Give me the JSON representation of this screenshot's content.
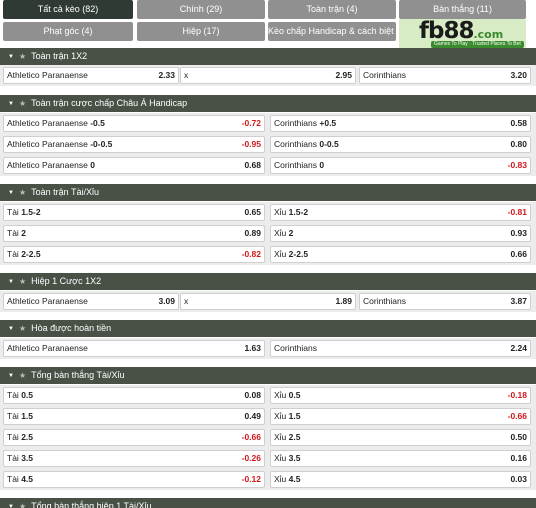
{
  "tabs": [
    {
      "label": "Tất cả kèo (82)"
    },
    {
      "label": "Chính (29)"
    },
    {
      "label": "Toàn trận (4)"
    },
    {
      "label": "Bàn thắng (11)"
    },
    {
      "label": "Phạt góc (4)"
    },
    {
      "label": "Hiệp (17)"
    },
    {
      "label": "Kèo chấp Handicap & cách biệt (3)"
    }
  ],
  "logo": {
    "name": "fb88",
    "domain": ".com",
    "tagline": "Games To Play · Trusted Places To Bet",
    "bg": "#d7ecc5"
  },
  "colors": {
    "section_header": "#495147",
    "active_tab": "#2f3a34",
    "inactive_tab": "#909090",
    "negative_odd": "#d0181b"
  },
  "sections": [
    {
      "title": "Toàn trận 1X2",
      "rows": [
        [
          {
            "label": "Athletico Paranaense",
            "odd": "2.33"
          },
          {
            "label": "x",
            "odd": "2.95"
          },
          {
            "label": "Corinthians",
            "odd": "3.20"
          }
        ]
      ]
    },
    {
      "title": "Toàn trận cược chấp Châu Á Handicap",
      "rows": [
        [
          {
            "label": "Athletico Paranaense",
            "line": "-0.5",
            "odd": "-0.72"
          },
          {
            "label": "Corinthians",
            "line": "+0.5",
            "odd": "0.58"
          }
        ],
        [
          {
            "label": "Athletico Paranaense",
            "line": "-0-0.5",
            "odd": "-0.95"
          },
          {
            "label": "Corinthians",
            "line": "0-0.5",
            "odd": "0.80"
          }
        ],
        [
          {
            "label": "Athletico Paranaense",
            "line": "0",
            "odd": "0.68"
          },
          {
            "label": "Corinthians",
            "line": "0",
            "odd": "-0.83"
          }
        ]
      ]
    },
    {
      "title": "Toàn trận Tài/Xỉu",
      "rows": [
        [
          {
            "label": "Tài",
            "line": "1.5-2",
            "odd": "0.65"
          },
          {
            "label": "Xỉu",
            "line": "1.5-2",
            "odd": "-0.81"
          }
        ],
        [
          {
            "label": "Tài",
            "line": "2",
            "odd": "0.89"
          },
          {
            "label": "Xỉu",
            "line": "2",
            "odd": "0.93"
          }
        ],
        [
          {
            "label": "Tài",
            "line": "2-2.5",
            "odd": "-0.82"
          },
          {
            "label": "Xỉu",
            "line": "2-2.5",
            "odd": "0.66"
          }
        ]
      ]
    },
    {
      "title": "Hiệp 1 Cược 1X2",
      "rows": [
        [
          {
            "label": "Athletico Paranaense",
            "odd": "3.09"
          },
          {
            "label": "x",
            "odd": "1.89"
          },
          {
            "label": "Corinthians",
            "odd": "3.87"
          }
        ]
      ]
    },
    {
      "title": "Hòa được hoàn tiền",
      "rows": [
        [
          {
            "label": "Athletico Paranaense",
            "odd": "1.63"
          },
          {
            "label": "Corinthians",
            "odd": "2.24"
          }
        ]
      ]
    },
    {
      "title": "Tổng bàn thắng Tài/Xỉu",
      "rows": [
        [
          {
            "label": "Tài",
            "line": "0.5",
            "odd": "0.08"
          },
          {
            "label": "Xỉu",
            "line": "0.5",
            "odd": "-0.18"
          }
        ],
        [
          {
            "label": "Tài",
            "line": "1.5",
            "odd": "0.49"
          },
          {
            "label": "Xỉu",
            "line": "1.5",
            "odd": "-0.66"
          }
        ],
        [
          {
            "label": "Tài",
            "line": "2.5",
            "odd": "-0.66"
          },
          {
            "label": "Xỉu",
            "line": "2.5",
            "odd": "0.50"
          }
        ],
        [
          {
            "label": "Tài",
            "line": "3.5",
            "odd": "-0.26"
          },
          {
            "label": "Xỉu",
            "line": "3.5",
            "odd": "0.16"
          }
        ],
        [
          {
            "label": "Tài",
            "line": "4.5",
            "odd": "-0.12"
          },
          {
            "label": "Xỉu",
            "line": "4.5",
            "odd": "0.03"
          }
        ]
      ]
    },
    {
      "title": "Tổng bàn thắng hiệp 1 Tài/Xỉu",
      "rows": []
    }
  ]
}
